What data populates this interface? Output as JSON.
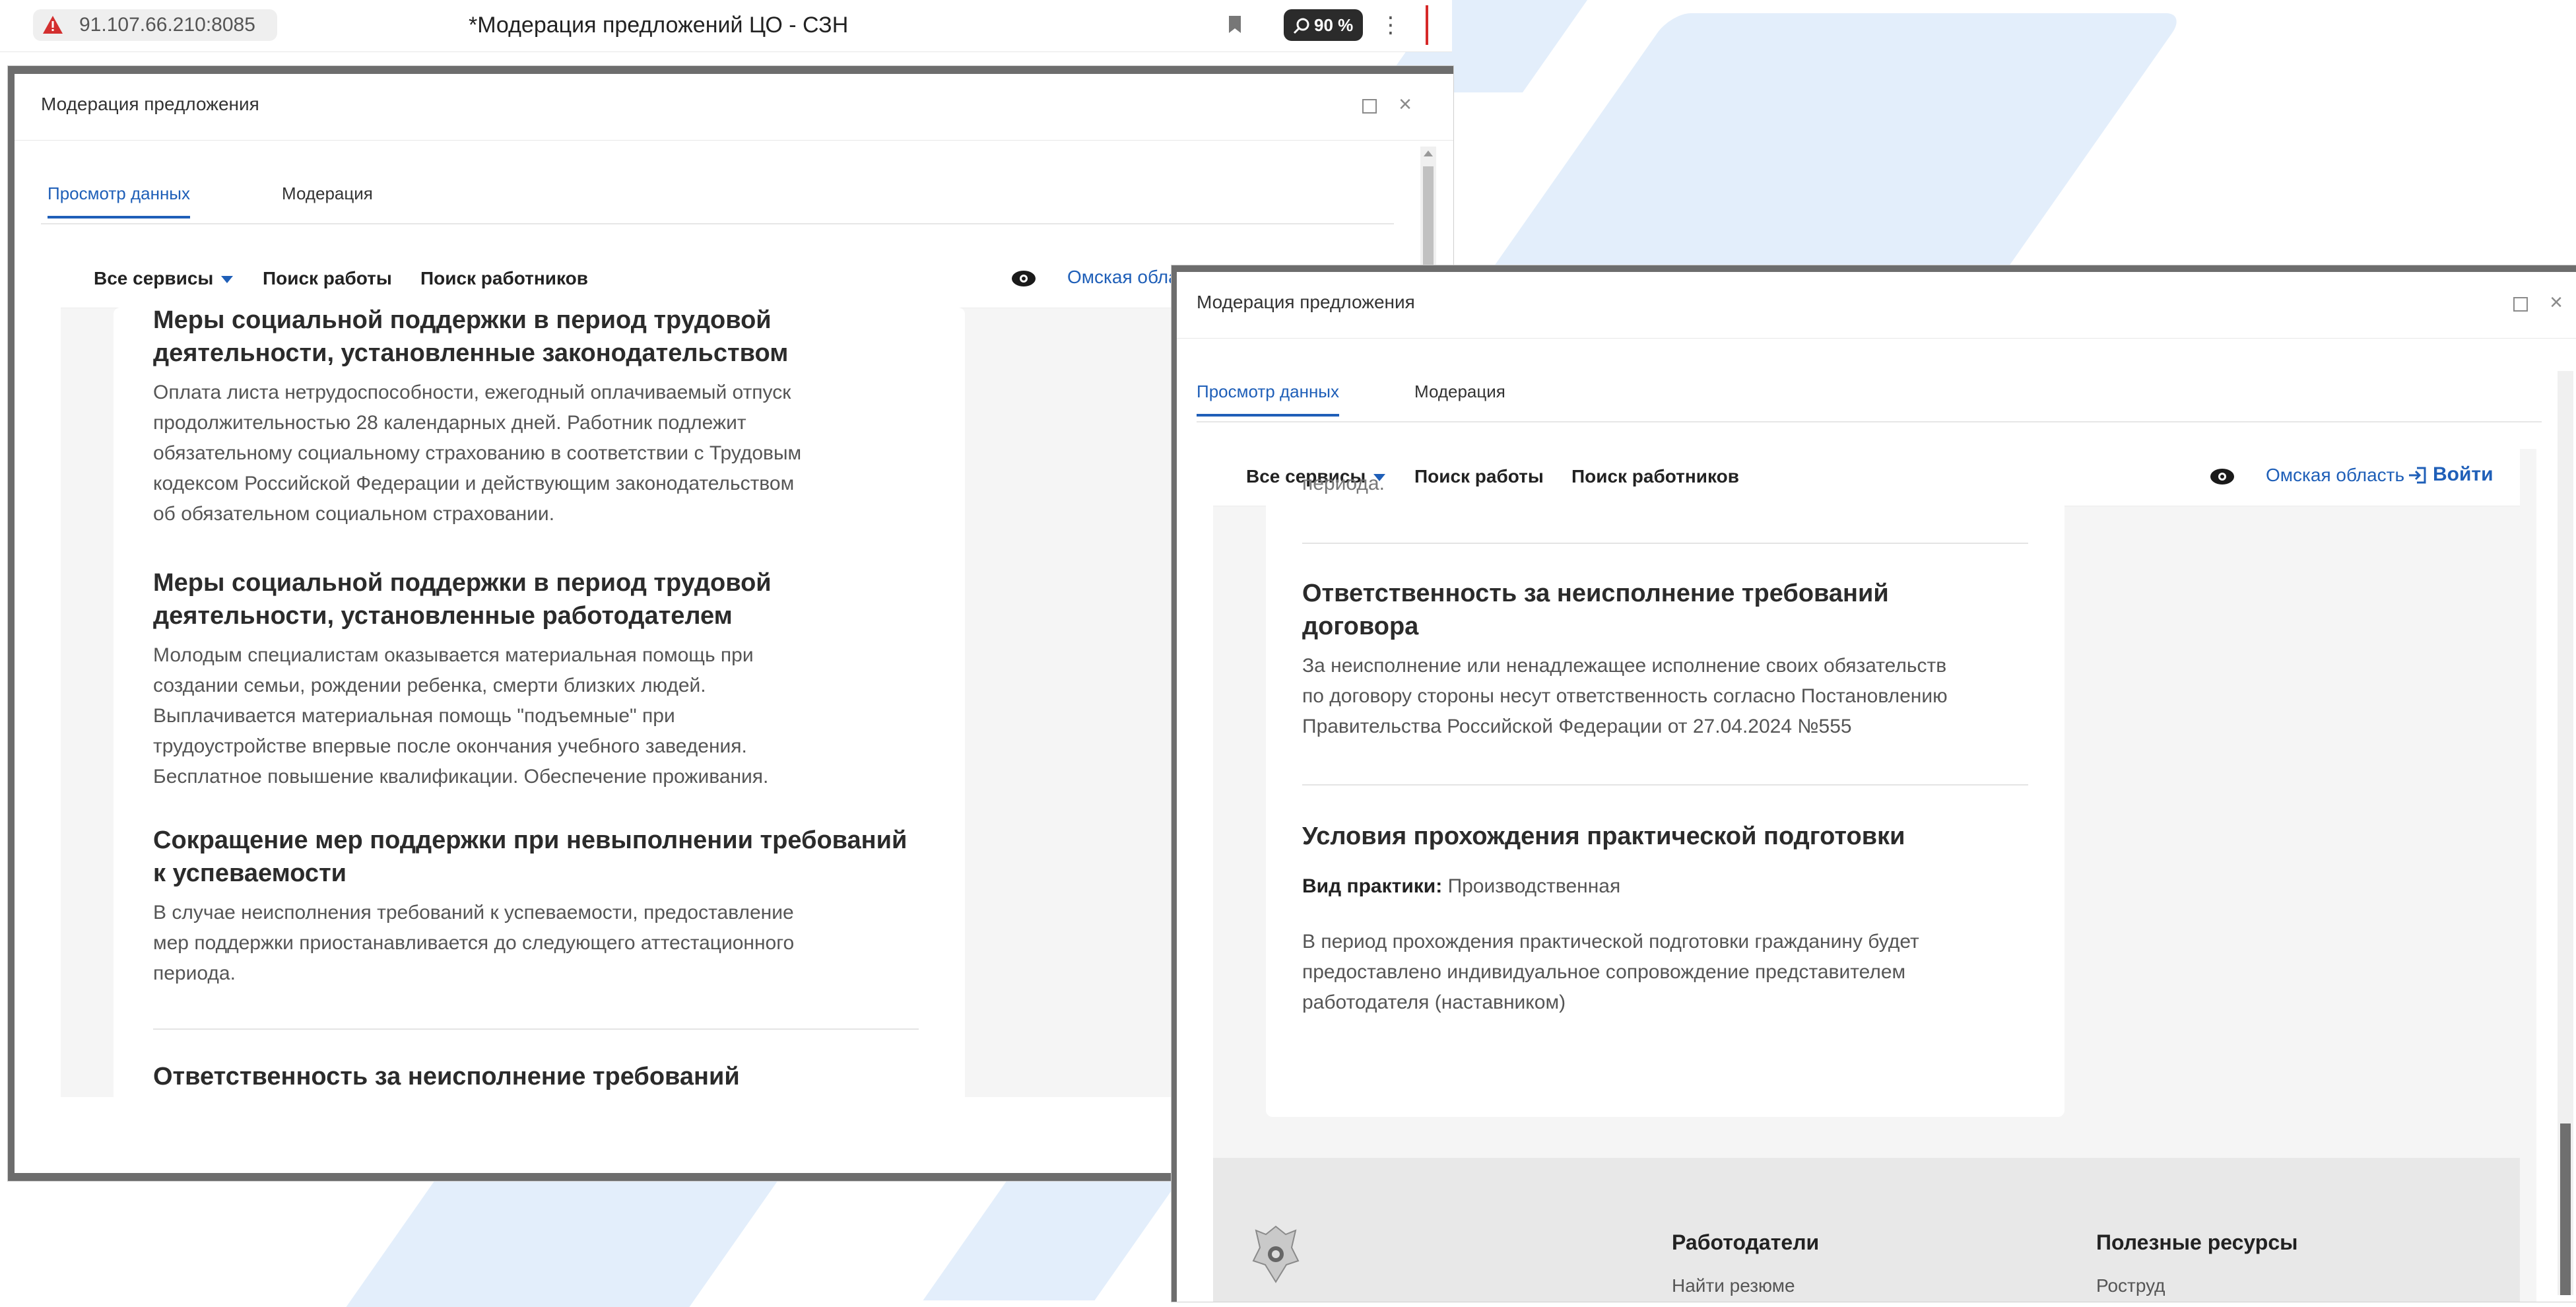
{
  "browser": {
    "url": "91.107.66.210:8085",
    "tab_title": "*Модерация предложений ЦО - СЗН",
    "zoom": "90 %"
  },
  "dialog": {
    "title": "Модерация предложения",
    "tabs": [
      "Просмотр данных",
      "Модерация"
    ]
  },
  "site_nav": {
    "all_services": "Все сервисы",
    "find_job": "Поиск работы",
    "find_workers": "Поиск работников",
    "region_full": "Омская область",
    "region_truncated": "Омская обла",
    "login": "Войти"
  },
  "window1": {
    "sections": [
      {
        "title_lines": [
          "Меры социальной поддержки в период трудовой",
          "деятельности, установленные законодательством"
        ],
        "body_lines": [
          "Оплата листа нетрудоспособности, ежегодный оплачиваемый отпуск",
          "продолжительностью 28 календарных дней. Работник подлежит",
          "обязательному социальному страхованию в соответствии с Трудовым",
          "кодексом Российской Федерации и действующим законодательством",
          "об обязательном социальном страховании."
        ]
      },
      {
        "title_lines": [
          "Меры социальной поддержки в период трудовой",
          "деятельности, установленные работодателем"
        ],
        "body_lines": [
          "Молодым специалистам оказывается материальная помощь при",
          "создании семьи, рождении ребенка, смерти близких людей.",
          "Выплачивается материальная помощь \"подъемные\" при",
          "трудоустройстве впервые после окончания учебного заведения.",
          "Бесплатное повышение квалификации. Обеспечение проживания."
        ]
      },
      {
        "title_lines": [
          "Сокращение мер поддержки при невыполнении требований",
          "к успеваемости"
        ],
        "body_lines": [
          "В случае неисполнения требований к успеваемости, предоставление",
          "мер поддержки приостанавливается до следующего аттестационного",
          "периода."
        ]
      },
      {
        "title_lines": [
          "Ответственность за неисполнение требований"
        ],
        "body_lines": []
      }
    ]
  },
  "window2": {
    "cut_text": "периода.",
    "liability": {
      "title_lines": [
        "Ответственность за неисполнение требований",
        "договора"
      ],
      "body_lines": [
        "За неисполнение или ненадлежащее исполнение своих обязательств",
        "по договору стороны несут ответственность согласно Постановлению",
        "Правительства Российской Федерации от 27.04.2024 №555"
      ]
    },
    "practice": {
      "title": "Условия прохождения практической подготовки",
      "type_label": "Вид практики:",
      "type_value": "Производственная",
      "body_lines": [
        "В период прохождения практической подготовки гражданину будет",
        "предоставлено индивидуальное сопровождение представителем",
        "работодателя (наставником)"
      ]
    },
    "footer": {
      "col1_title": "Работодатели",
      "col1_link": "Найти резюме",
      "col2_title": "Полезные ресурсы",
      "col2_link": "Роструд"
    }
  },
  "colors": {
    "accent": "#1f5fb8",
    "frame": "#6d6d6d",
    "background_shape": "#e3eefb"
  }
}
